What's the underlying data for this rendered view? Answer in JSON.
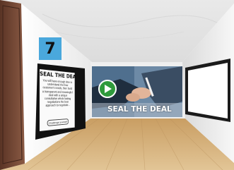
{
  "room": {
    "number": "7"
  },
  "poster": {
    "title": "SEAL THE DEAL",
    "body": "You will have enough time to understand the finer customer's needs, then build a transparent and meaningful deal with a unique consultative whole lasting negotiations the best approach to negotiate...",
    "button_label": "Challenge yourself"
  },
  "video": {
    "title": "SEAL THE DEAL",
    "play_icon": "play-icon"
  },
  "colors": {
    "room_number_bg": "#4aa8dc",
    "play_button": "#2f9a3c",
    "floor": "#d8b988",
    "wall": "#f2f2f2"
  }
}
